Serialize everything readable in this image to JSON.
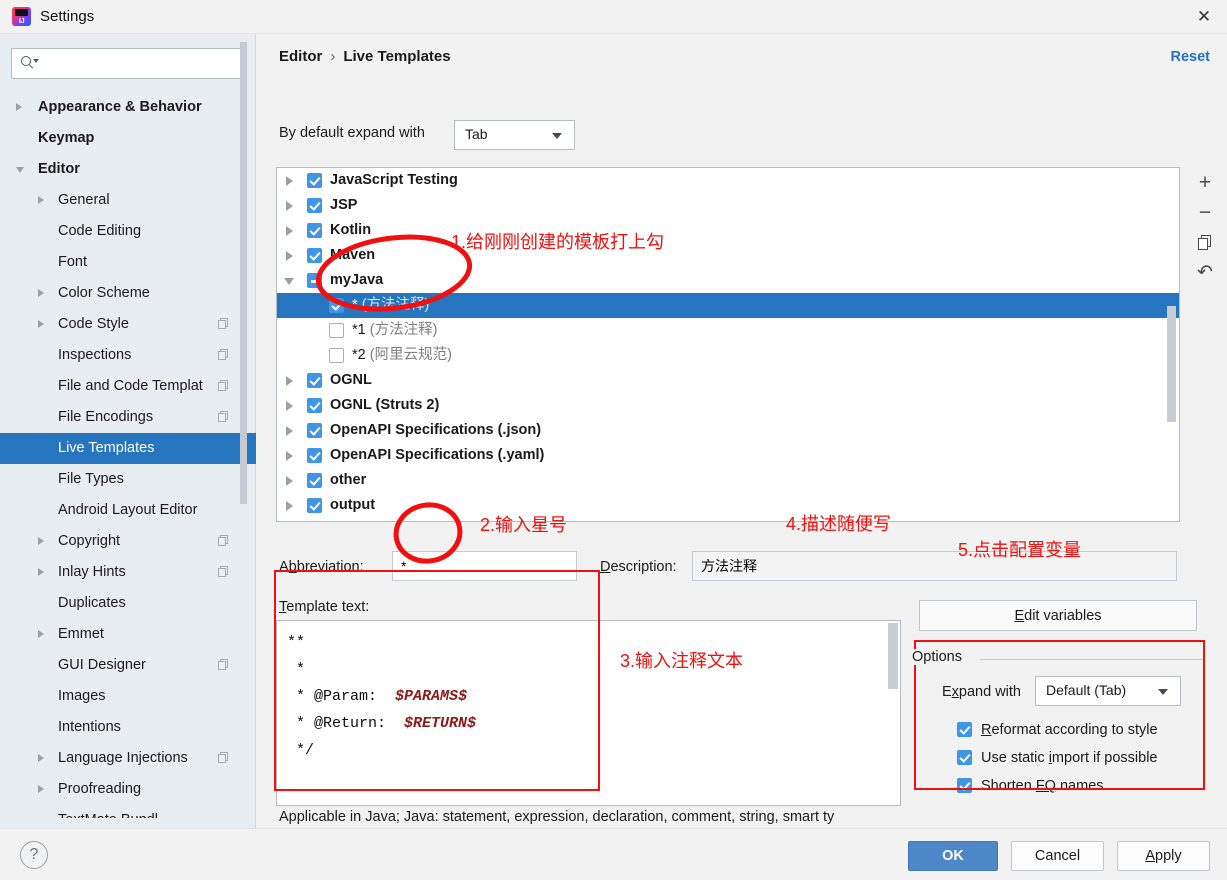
{
  "window": {
    "title": "Settings",
    "logo_text": "IJ",
    "close_icon": "close-icon"
  },
  "sidebar": {
    "search": {
      "value": "",
      "placeholder": ""
    },
    "items": [
      {
        "label": "Appearance & Behavior",
        "level": 0,
        "arrow": "right",
        "bold": true,
        "copy": false,
        "selected": false
      },
      {
        "label": "Keymap",
        "level": 0,
        "arrow": "none",
        "bold": true,
        "copy": false,
        "selected": false
      },
      {
        "label": "Editor",
        "level": 0,
        "arrow": "down",
        "bold": true,
        "copy": false,
        "selected": false
      },
      {
        "label": "General",
        "level": 1,
        "arrow": "right",
        "bold": false,
        "copy": false,
        "selected": false
      },
      {
        "label": "Code Editing",
        "level": 1,
        "arrow": "none",
        "bold": false,
        "copy": false,
        "selected": false
      },
      {
        "label": "Font",
        "level": 1,
        "arrow": "none",
        "bold": false,
        "copy": false,
        "selected": false
      },
      {
        "label": "Color Scheme",
        "level": 1,
        "arrow": "right",
        "bold": false,
        "copy": false,
        "selected": false
      },
      {
        "label": "Code Style",
        "level": 1,
        "arrow": "right",
        "bold": false,
        "copy": true,
        "selected": false
      },
      {
        "label": "Inspections",
        "level": 1,
        "arrow": "none",
        "bold": false,
        "copy": true,
        "selected": false
      },
      {
        "label": "File and Code Templat",
        "level": 1,
        "arrow": "none",
        "bold": false,
        "copy": true,
        "selected": false
      },
      {
        "label": "File Encodings",
        "level": 1,
        "arrow": "none",
        "bold": false,
        "copy": true,
        "selected": false
      },
      {
        "label": "Live Templates",
        "level": 1,
        "arrow": "none",
        "bold": false,
        "copy": false,
        "selected": true
      },
      {
        "label": "File Types",
        "level": 1,
        "arrow": "none",
        "bold": false,
        "copy": false,
        "selected": false
      },
      {
        "label": "Android Layout Editor",
        "level": 1,
        "arrow": "none",
        "bold": false,
        "copy": false,
        "selected": false
      },
      {
        "label": "Copyright",
        "level": 1,
        "arrow": "right",
        "bold": false,
        "copy": true,
        "selected": false
      },
      {
        "label": "Inlay Hints",
        "level": 1,
        "arrow": "right",
        "bold": false,
        "copy": true,
        "selected": false
      },
      {
        "label": "Duplicates",
        "level": 1,
        "arrow": "none",
        "bold": false,
        "copy": false,
        "selected": false
      },
      {
        "label": "Emmet",
        "level": 1,
        "arrow": "right",
        "bold": false,
        "copy": false,
        "selected": false
      },
      {
        "label": "GUI Designer",
        "level": 1,
        "arrow": "none",
        "bold": false,
        "copy": true,
        "selected": false
      },
      {
        "label": "Images",
        "level": 1,
        "arrow": "none",
        "bold": false,
        "copy": false,
        "selected": false
      },
      {
        "label": "Intentions",
        "level": 1,
        "arrow": "none",
        "bold": false,
        "copy": false,
        "selected": false
      },
      {
        "label": "Language Injections",
        "level": 1,
        "arrow": "right",
        "bold": false,
        "copy": true,
        "selected": false
      },
      {
        "label": "Proofreading",
        "level": 1,
        "arrow": "right",
        "bold": false,
        "copy": false,
        "selected": false
      },
      {
        "label": "TextMate Bundl",
        "level": 1,
        "arrow": "none",
        "bold": false,
        "copy": false,
        "selected": false
      }
    ]
  },
  "header": {
    "breadcrumb_root": "Editor",
    "breadcrumb_sep": "›",
    "breadcrumb_leaf": "Live Templates",
    "reset_label": "Reset"
  },
  "expand": {
    "label": "By default expand with",
    "value": "Tab"
  },
  "tree": {
    "rows": [
      {
        "label": "JavaScript Testing",
        "kind": "group",
        "arrow": "right",
        "check": "on"
      },
      {
        "label": "JSP",
        "kind": "group",
        "arrow": "right",
        "check": "on"
      },
      {
        "label": "Kotlin",
        "kind": "group",
        "arrow": "right",
        "check": "on"
      },
      {
        "label": "Maven",
        "kind": "group",
        "arrow": "right",
        "check": "on"
      },
      {
        "label": "myJava",
        "kind": "group",
        "arrow": "down",
        "check": "partial"
      },
      {
        "label": "*",
        "note": "(方法注释)",
        "kind": "leaf",
        "arrow": "none",
        "check": "on",
        "selected": true
      },
      {
        "label": "*1",
        "note": "(方法注释)",
        "kind": "leaf",
        "arrow": "none",
        "check": "off"
      },
      {
        "label": "*2",
        "note": "(阿里云规范)",
        "kind": "leaf",
        "arrow": "none",
        "check": "off"
      },
      {
        "label": "OGNL",
        "kind": "group",
        "arrow": "right",
        "check": "on"
      },
      {
        "label": "OGNL (Struts 2)",
        "kind": "group",
        "arrow": "right",
        "check": "on"
      },
      {
        "label": "OpenAPI Specifications (.json)",
        "kind": "group",
        "arrow": "right",
        "check": "on"
      },
      {
        "label": "OpenAPI Specifications (.yaml)",
        "kind": "group",
        "arrow": "right",
        "check": "on"
      },
      {
        "label": "other",
        "kind": "group",
        "arrow": "right",
        "check": "on"
      },
      {
        "label": "output",
        "kind": "group",
        "arrow": "right",
        "check": "on"
      }
    ],
    "toolbar": [
      {
        "icon": "plus-icon",
        "label": "+"
      },
      {
        "icon": "minus-icon",
        "label": "−"
      },
      {
        "icon": "copy-icon",
        "label": ""
      },
      {
        "icon": "revert-icon",
        "label": "↶"
      }
    ]
  },
  "fields": {
    "abbreviation_label_pre": "A",
    "abbreviation_label_mnem": "b",
    "abbreviation_label_post": "breviation:",
    "abbreviation_value": "*",
    "description_label_mnem": "D",
    "description_label_post": "escription:",
    "description_value": "方法注释",
    "template_text_label_mnem": "T",
    "template_text_label_post": "emplate text:",
    "template_code_l1": "**",
    "template_code_l2": " *",
    "template_code_l3_pre": " * @Param:  ",
    "template_code_l3_var": "$PARAMS$",
    "template_code_l4_pre": " * @Return:  ",
    "template_code_l4_var": "$RETURN$",
    "template_code_l5": " */",
    "applicable_text": "Applicable in Java; Java: statement, expression, declaration, comment, string, smart ty"
  },
  "options": {
    "edit_variables_mnem": "E",
    "edit_variables_post": "dit variables",
    "group_title": "Options",
    "expand_with_pre": "E",
    "expand_with_mnem": "x",
    "expand_with_post": "pand with",
    "expand_with_value": "Default (Tab)",
    "checks": [
      {
        "pre": "",
        "mnem": "R",
        "post": "eformat according to style",
        "checked": true
      },
      {
        "pre": "Use static ",
        "mnem": "i",
        "post": "mport if possible",
        "checked": true
      },
      {
        "pre": "Shorten ",
        "mnem": "FQ",
        "post": " names",
        "checked": true
      }
    ]
  },
  "footer": {
    "help_label": "?",
    "ok_label": "OK",
    "cancel_label": "Cancel",
    "apply_mnem": "A",
    "apply_post": "pply"
  },
  "annotations": {
    "accent_color": "#f01010",
    "notes": [
      {
        "id": "a1",
        "text": "1.给刚刚创建的模板打上勾"
      },
      {
        "id": "a2",
        "text": "2.输入星号"
      },
      {
        "id": "a3",
        "text": "3.输入注释文本"
      },
      {
        "id": "a4",
        "text": "4.描述随便写"
      },
      {
        "id": "a5",
        "text": "5.点击配置变量"
      }
    ]
  }
}
